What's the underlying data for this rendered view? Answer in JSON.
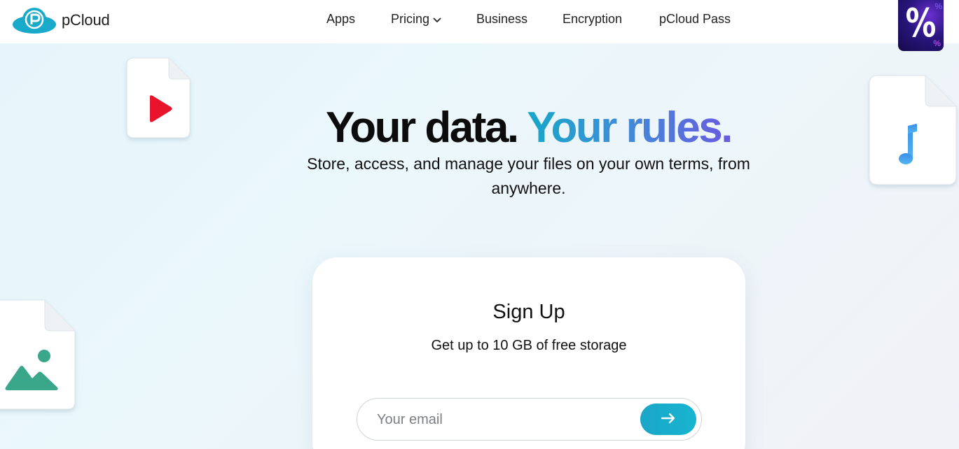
{
  "header": {
    "brand": "pCloud",
    "nav": [
      {
        "label": "Apps"
      },
      {
        "label": "Pricing",
        "has_dropdown": true
      },
      {
        "label": "Business"
      },
      {
        "label": "Encryption"
      },
      {
        "label": "pCloud Pass"
      }
    ],
    "promo_symbol": "%"
  },
  "hero": {
    "title_part1": "Your data.",
    "title_part2": "Your rules.",
    "subtitle": "Store, access, and manage your files on your own terms, from anywhere."
  },
  "signup": {
    "title": "Sign Up",
    "subtitle": "Get up to 10 GB of free storage",
    "email_placeholder": "Your email",
    "email_value": ""
  },
  "decor": {
    "file_cards": [
      "video-file-icon",
      "music-file-icon",
      "image-file-icon"
    ]
  },
  "colors": {
    "brand": "#19a9c9",
    "accent_gradient": [
      "#17a7c8",
      "#6a5ae0"
    ],
    "play": "#e8142c",
    "music": "#3a8fe8",
    "image": "#3aa68a"
  }
}
